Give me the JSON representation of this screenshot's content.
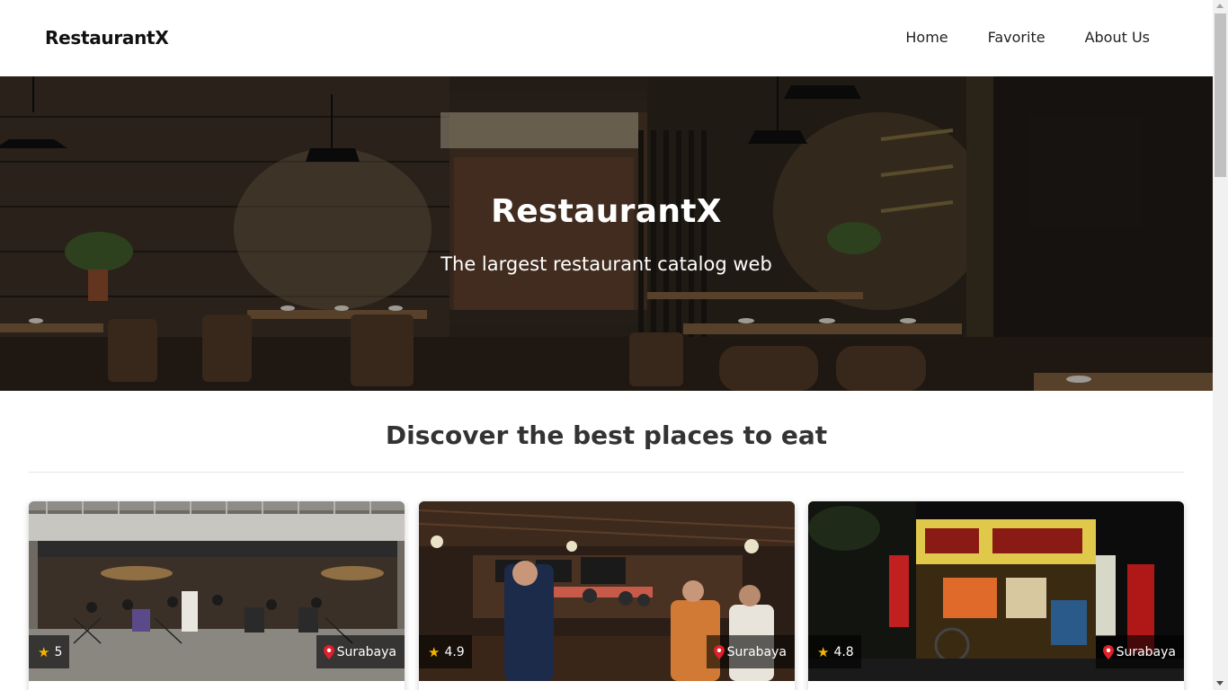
{
  "header": {
    "brand": "RestaurantX",
    "nav": [
      "Home",
      "Favorite",
      "About Us"
    ]
  },
  "hero": {
    "title": "RestaurantX",
    "subtitle": "The largest restaurant catalog web"
  },
  "main": {
    "section_title": "Discover the best places to eat"
  },
  "restaurants": [
    {
      "rating": "5",
      "city": "Surabaya"
    },
    {
      "rating": "4.9",
      "city": "Surabaya"
    },
    {
      "rating": "4.8",
      "city": "Surabaya"
    }
  ],
  "icons": {
    "rating": "star-icon",
    "city": "location-pin-icon"
  },
  "colors": {
    "star": "#f5b400",
    "pin": "#e0202a",
    "badge_bg": "rgba(0,0,0,0.6)"
  }
}
